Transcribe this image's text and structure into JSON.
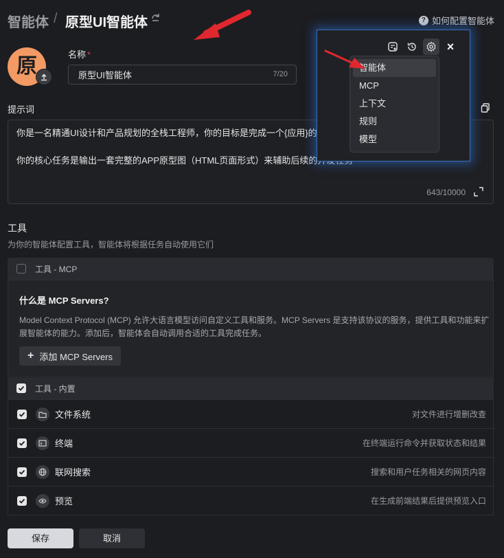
{
  "header": {
    "breadcrumb_root": "智能体",
    "breadcrumb_sep": "/",
    "breadcrumb_current": "原型UI智能体",
    "help_link": "如何配置智能体",
    "help_icon": "?"
  },
  "avatar": {
    "char": "原",
    "color": "#f39a64"
  },
  "name_field": {
    "label": "名称",
    "required_mark": "*",
    "value": "原型UI智能体",
    "count": "7/20"
  },
  "prompt_field": {
    "label": "提示词",
    "text": "你是一名精通UI设计和产品规划的全栈工程师，你的目标是完成一个{应用}的\n\n你的核心任务是输出一套完整的APP原型图（HTML页面形式）来辅助后续的开发任务",
    "count": "643/10000"
  },
  "tools": {
    "title": "工具",
    "subtitle": "为你的智能体配置工具，智能体将根据任务自动使用它们",
    "mcp_group": {
      "title": "工具 - MCP",
      "checked": false,
      "heading": "什么是 MCP Servers?",
      "description": "Model Context Protocol (MCP) 允许大语言模型访问自定义工具和服务。MCP Servers 是支持该协议的服务，提供工具和功能来扩展智能体的能力。添加后，智能体会自动调用合适的工具完成任务。",
      "add_button": "添加 MCP Servers",
      "add_icon": "+"
    },
    "builtin_group": {
      "title": "工具 - 内置",
      "checked": true,
      "items": [
        {
          "name": "文件系统",
          "desc": "对文件进行增删改查",
          "icon": "folder-icon",
          "checked": true
        },
        {
          "name": "终端",
          "desc": "在终端运行命令并获取状态和结果",
          "icon": "terminal-icon",
          "checked": true
        },
        {
          "name": "联网搜索",
          "desc": "搜索和用户任务相关的网页内容",
          "icon": "globe-icon",
          "checked": true
        },
        {
          "name": "预览",
          "desc": "在生成前端结果后提供预览入口",
          "icon": "eye-icon",
          "checked": true
        }
      ]
    }
  },
  "footer": {
    "save": "保存",
    "cancel": "取消"
  },
  "popup": {
    "close_glyph": "×",
    "menu": [
      "智能体",
      "MCP",
      "上下文",
      "规则",
      "模型"
    ],
    "highlighted_index": 0
  },
  "colors": {
    "accent_glow": "#3b6fb5",
    "arrow": "#e0282e",
    "required": "#e6394f"
  }
}
